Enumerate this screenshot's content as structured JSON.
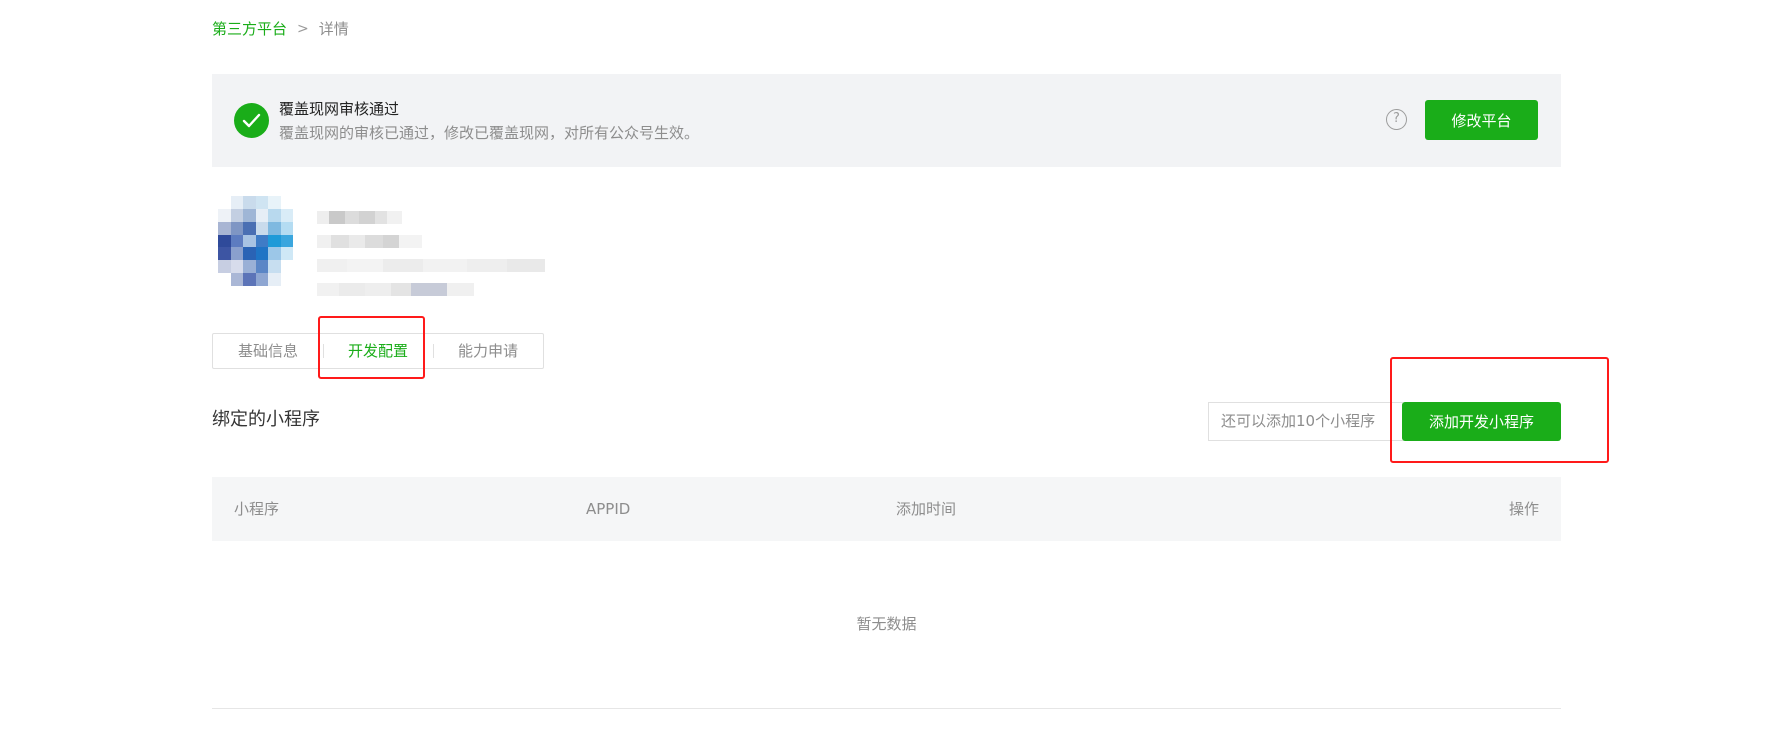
{
  "breadcrumb": {
    "parent": "第三方平台",
    "separator": ">",
    "current": "详情"
  },
  "banner": {
    "title": "覆盖现网审核通过",
    "description": "覆盖现网的审核已通过，修改已覆盖现网，对所有公众号生效。",
    "help_icon": "?",
    "modify_button": "修改平台"
  },
  "tabs": [
    {
      "label": "基础信息",
      "active": false
    },
    {
      "label": "开发配置",
      "active": true
    },
    {
      "label": "能力申请",
      "active": false
    }
  ],
  "section": {
    "title": "绑定的小程序",
    "quota_text": "还可以添加10个小程序",
    "add_button": "添加开发小程序"
  },
  "table": {
    "columns": [
      "小程序",
      "APPID",
      "添加时间",
      "操作"
    ],
    "empty_text": "暂无数据"
  },
  "colors": {
    "accent": "#1aad19",
    "annotation": "#ff1a1a",
    "banner_bg": "#f2f3f5",
    "table_head_bg": "#f5f6f7"
  }
}
